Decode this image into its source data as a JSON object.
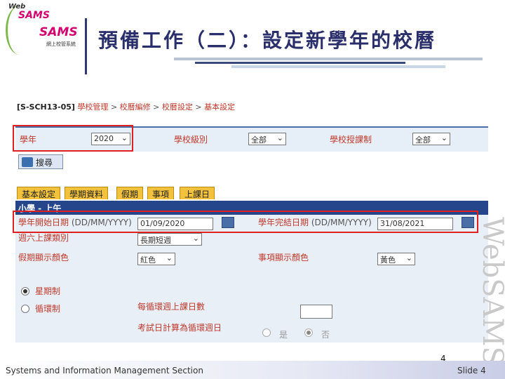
{
  "logo": {
    "web": "Web",
    "sams_top": "SAMS",
    "sams_bottom": "SAMS",
    "subtitle": "網上校管系統"
  },
  "slide_title": "預備工作（二）：設定新學年的校曆",
  "breadcrumb": {
    "code": "[S-SCH13-05]",
    "items": [
      "學校管理",
      "校曆編修",
      "校曆設定",
      "基本設定"
    ],
    "separator": ">"
  },
  "filters": {
    "school_year_label": "學年",
    "school_year_value": "2020",
    "school_level_label": "學校級別",
    "school_level_value": "全部",
    "school_session_label": "學校授課制",
    "school_session_value": "全部"
  },
  "search_button": "搜尋",
  "tabs": [
    "基本設定",
    "學期資料",
    "假期",
    "事項",
    "上課日"
  ],
  "panel_title": "小學 - 上午",
  "form": {
    "start_date_label": "學年開始日期",
    "start_date_hint": "(DD/MM/YYYY)",
    "start_date_value": "01/09/2020",
    "end_date_label": "學年完結日期",
    "end_date_hint": "(DD/MM/YYYY)",
    "end_date_value": "31/08/2021",
    "weekly_type_label": "週六上課類別",
    "weekly_type_value": "長期短週",
    "holiday_color_label": "假期顯示顏色",
    "holiday_color_value": "紅色",
    "event_color_label": "事項顯示顏色",
    "event_color_value": "黃色",
    "cycle_week_label": "星期制",
    "cycle_label": "循環制",
    "cycle_days_label": "每循環週上課日數",
    "exam_cycle_label": "考試日計算為循環週日",
    "yes_label": "是",
    "no_label": "否"
  },
  "page_number": "4",
  "footer": {
    "left": "Systems and Information Management Section",
    "right": "Slide 4"
  },
  "watermark": "WebSAMS",
  "colors": {
    "title": "#2a2f6b",
    "label_red": "#c0392b",
    "highlight": "#e02020",
    "tab": "#f3c23c",
    "panel_header": "#26468c"
  }
}
